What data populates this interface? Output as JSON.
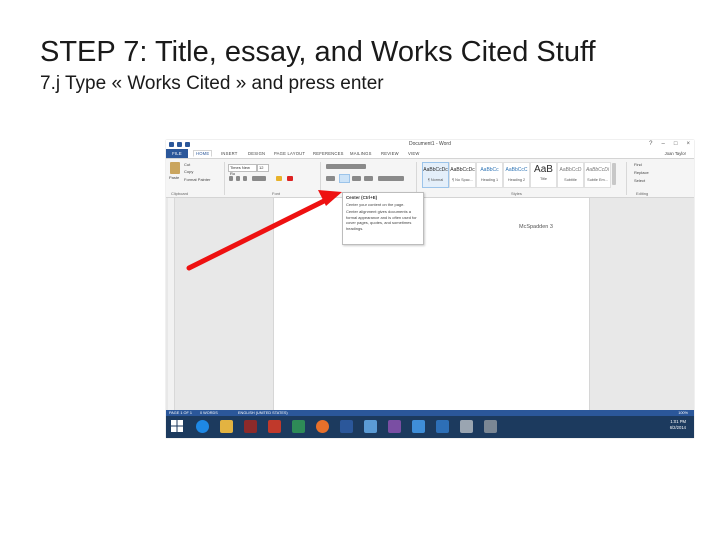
{
  "slide": {
    "title": "STEP 7: Title, essay, and Works Cited Stuff",
    "subtitle": "7.j Type « Works Cited » and press enter"
  },
  "word": {
    "window_title": "Document1 - Word",
    "tabs": [
      "FILE",
      "HOME",
      "INSERT",
      "DESIGN",
      "PAGE LAYOUT",
      "REFERENCES",
      "MAILINGS",
      "REVIEW",
      "VIEW"
    ],
    "active_tab": "HOME",
    "user": "Joan Taylor",
    "clipboard": {
      "paste": "Paste",
      "cut": "Cut",
      "copy": "Copy",
      "format_painter": "Format Painter",
      "label": "Clipboard"
    },
    "font": {
      "name": "Times New Ro",
      "size": "12",
      "label": "Font"
    },
    "paragraph_label": "Paragraph",
    "styles": [
      {
        "sample": "AaBbCcDc",
        "name": "¶ Normal"
      },
      {
        "sample": "AaBbCcDc",
        "name": "¶ No Spac..."
      },
      {
        "sample": "AaBbCc",
        "name": "Heading 1"
      },
      {
        "sample": "AaBbCcC",
        "name": "Heading 2"
      },
      {
        "sample": "AaB",
        "name": "Title"
      },
      {
        "sample": "AaBbCcD",
        "name": "Subtitle"
      },
      {
        "sample": "AaBbCcDi",
        "name": "Subtle Em..."
      }
    ],
    "styles_label": "Styles",
    "editing": {
      "find": "Find",
      "replace": "Replace",
      "select": "Select",
      "label": "Editing"
    },
    "tooltip": {
      "title": "Center (Ctrl+E)",
      "line1": "Center your content on the page.",
      "line2": "Center alignment gives documents a formal appearance and is often used for cover pages, quotes, and sometimes headings."
    },
    "header_text": "McSpadden 3",
    "status": {
      "page": "PAGE 1 OF 1",
      "words": "0 WORDS",
      "lang": "ENGLISH (UNITED STATES)",
      "zoom": "100%"
    },
    "clock": {
      "time": "1:01 PM",
      "date": "6/2/2014"
    }
  }
}
